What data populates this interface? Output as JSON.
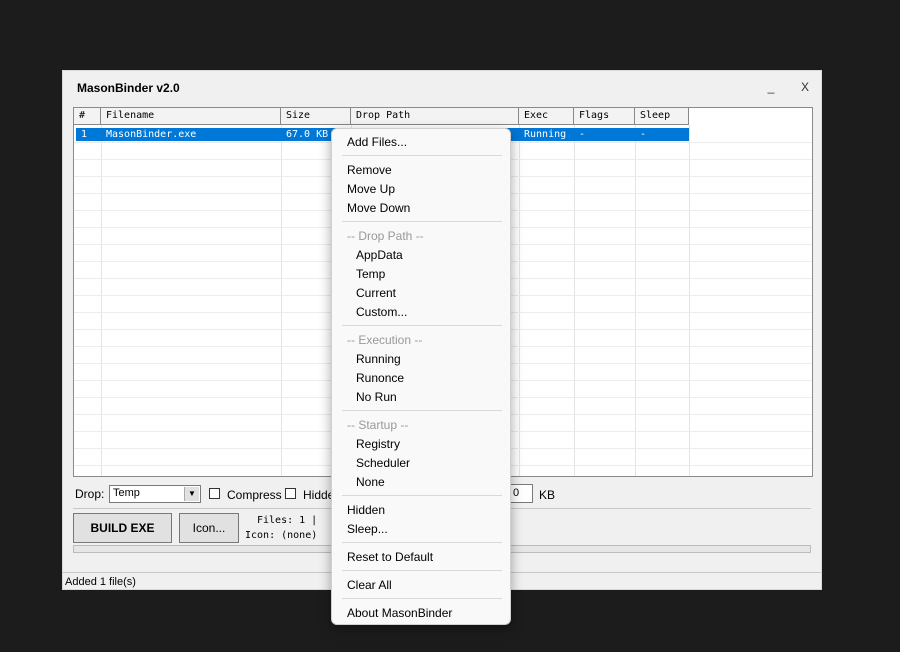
{
  "window": {
    "title": "MasonBinder v2.0",
    "minimize": "_",
    "close": "X"
  },
  "grid": {
    "columns": [
      "#",
      "Filename",
      "Size",
      "Drop Path",
      "Exec",
      "Flags",
      "Sleep"
    ],
    "rows": [
      {
        "num": "1",
        "filename": "MasonBinder.exe",
        "size": "67.0 KB",
        "exec": "Running",
        "flags": "-",
        "sleep": "-"
      }
    ]
  },
  "options": {
    "drop_label": "Drop:",
    "drop_value": "Temp",
    "compress_label": "Compress",
    "hidden_label": "Hidde",
    "size_value": "0",
    "size_unit": "KB"
  },
  "actions": {
    "build": "BUILD EXE",
    "icon": "Icon...",
    "files_info": "Files: 1  |",
    "icon_info": "Icon: (none)"
  },
  "status": "Added 1 file(s)",
  "context_menu": {
    "add_files": "Add Files...",
    "remove": "Remove",
    "move_up": "Move Up",
    "move_down": "Move Down",
    "drop_path_header": "-- Drop Path --",
    "appdata": "AppData",
    "temp": "Temp",
    "current": "Current",
    "custom": "Custom...",
    "execution_header": "-- Execution --",
    "running": "Running",
    "runonce": "Runonce",
    "no_run": "No Run",
    "startup_header": "-- Startup --",
    "registry": "Registry",
    "scheduler": "Scheduler",
    "none": "None",
    "hidden": "Hidden",
    "sleep": "Sleep...",
    "reset": "Reset to Default",
    "clear_all": "Clear All",
    "about": "About MasonBinder"
  },
  "colors": {
    "selection": "#0078d7",
    "desktop": "#1c1c1c"
  }
}
